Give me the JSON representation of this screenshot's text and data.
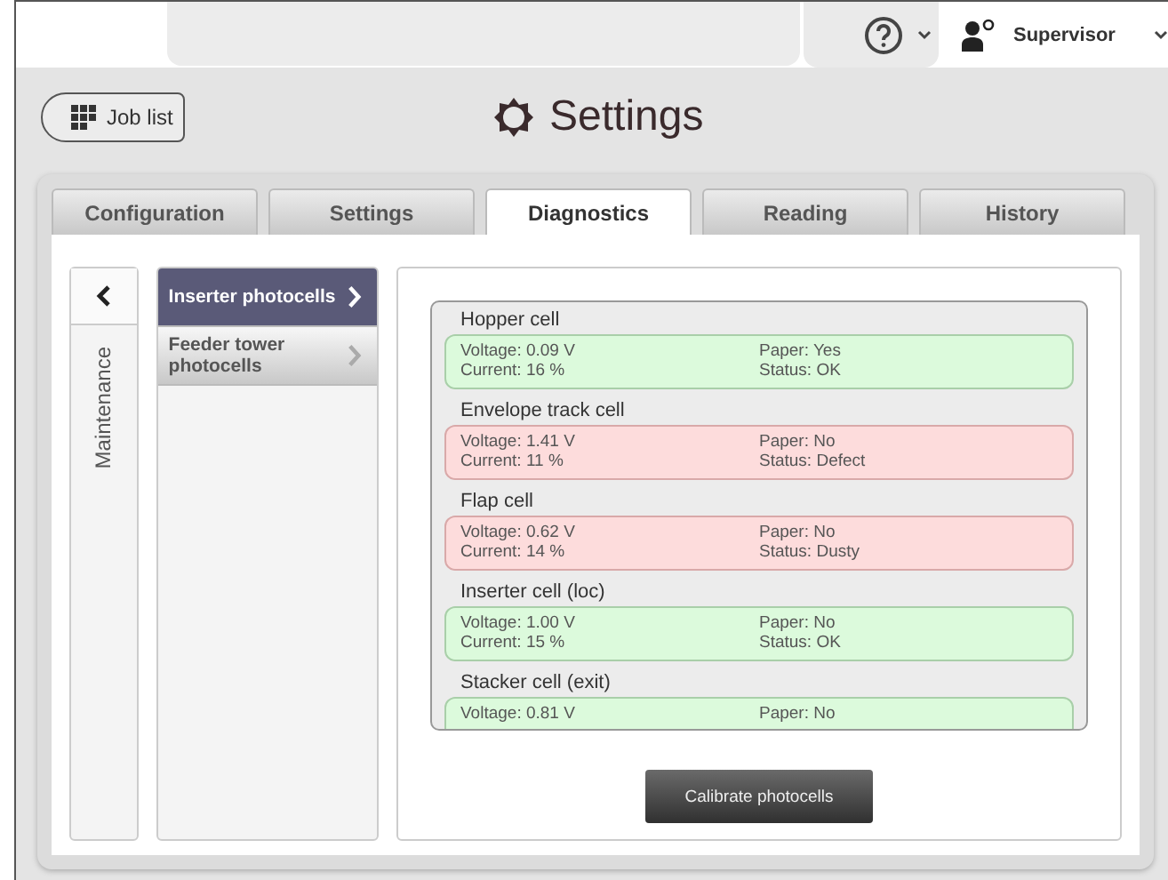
{
  "top_bar": {
    "user": "Supervisor"
  },
  "header": {
    "back_button": "Job list",
    "title": "Settings"
  },
  "tabs": [
    {
      "label": "Configuration",
      "selected": false
    },
    {
      "label": "Settings",
      "selected": false
    },
    {
      "label": "Diagnostics",
      "selected": true
    },
    {
      "label": "Reading",
      "selected": false
    },
    {
      "label": "History",
      "selected": false
    }
  ],
  "side_rail": {
    "label": "Maintenance"
  },
  "menu": [
    {
      "label": "Inserter photocells",
      "selected": true
    },
    {
      "label": "Feeder tower photocells",
      "selected": false
    }
  ],
  "cells": [
    {
      "name": "Hopper cell",
      "kind": "ok",
      "voltage": "Voltage: 0.09 V",
      "current": "Current: 16 %",
      "paper": "Paper: Yes",
      "status": "Status: OK"
    },
    {
      "name": "Envelope track cell",
      "kind": "fault",
      "voltage": "Voltage: 1.41 V",
      "current": "Current: 11 %",
      "paper": "Paper: No",
      "status": "Status: Defect"
    },
    {
      "name": "Flap cell",
      "kind": "fault",
      "voltage": "Voltage: 0.62 V",
      "current": "Current: 14 %",
      "paper": "Paper: No",
      "status": "Status: Dusty"
    },
    {
      "name": "Inserter cell (loc)",
      "kind": "ok",
      "voltage": "Voltage: 1.00 V",
      "current": "Current: 15 %",
      "paper": "Paper: No",
      "status": "Status: OK"
    },
    {
      "name": "Stacker cell (exit)",
      "kind": "ok",
      "voltage": "Voltage: 0.81 V",
      "paper": "Paper: No"
    }
  ],
  "calibrate_button": "Calibrate photocells"
}
